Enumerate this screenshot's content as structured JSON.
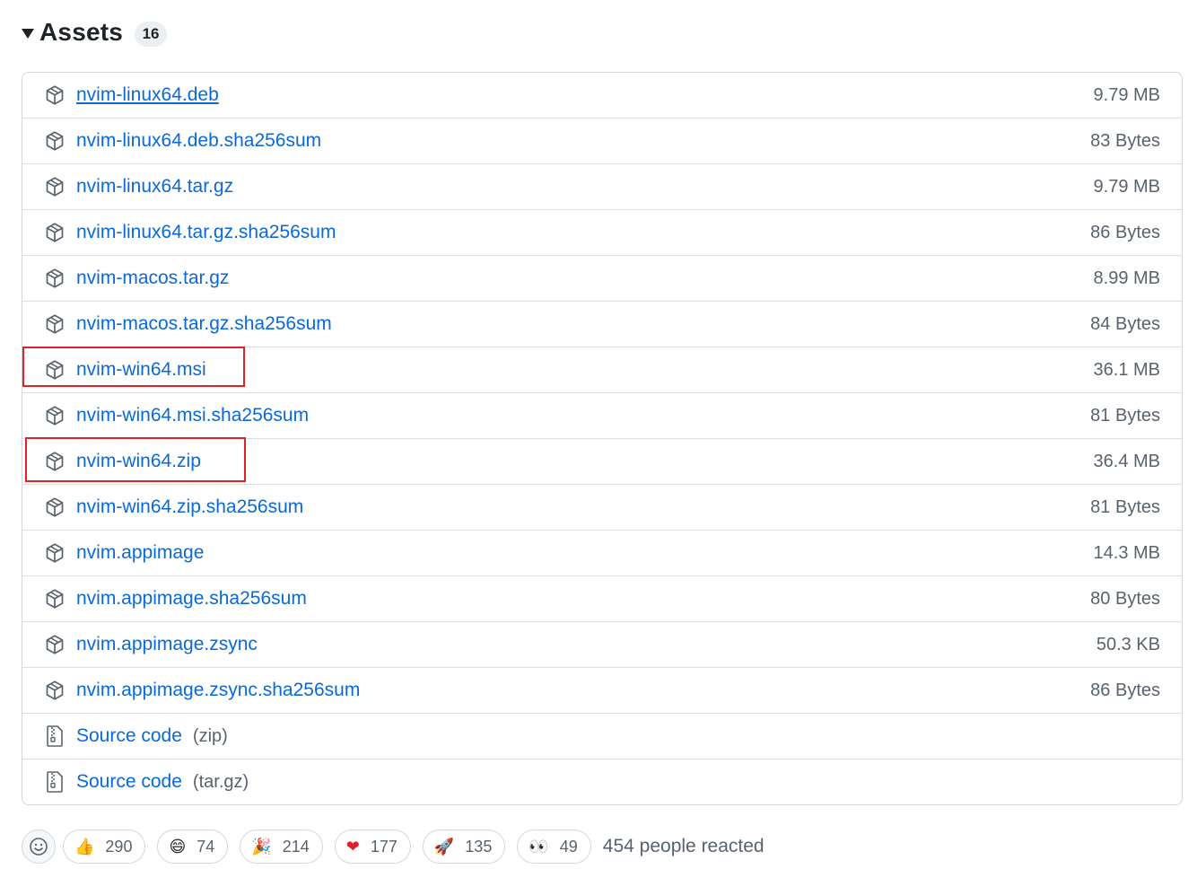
{
  "assets": {
    "title": "Assets",
    "count": "16",
    "files": [
      {
        "name": "nvim-linux64.deb",
        "size": "9.79 MB"
      },
      {
        "name": "nvim-linux64.deb.sha256sum",
        "size": "83 Bytes"
      },
      {
        "name": "nvim-linux64.tar.gz",
        "size": "9.79 MB"
      },
      {
        "name": "nvim-linux64.tar.gz.sha256sum",
        "size": "86 Bytes"
      },
      {
        "name": "nvim-macos.tar.gz",
        "size": "8.99 MB"
      },
      {
        "name": "nvim-macos.tar.gz.sha256sum",
        "size": "84 Bytes"
      },
      {
        "name": "nvim-win64.msi",
        "size": "36.1 MB"
      },
      {
        "name": "nvim-win64.msi.sha256sum",
        "size": "81 Bytes"
      },
      {
        "name": "nvim-win64.zip",
        "size": "36.4 MB"
      },
      {
        "name": "nvim-win64.zip.sha256sum",
        "size": "81 Bytes"
      },
      {
        "name": "nvim.appimage",
        "size": "14.3 MB"
      },
      {
        "name": "nvim.appimage.sha256sum",
        "size": "80 Bytes"
      },
      {
        "name": "nvim.appimage.zsync",
        "size": "50.3 KB"
      },
      {
        "name": "nvim.appimage.zsync.sha256sum",
        "size": "86 Bytes"
      }
    ],
    "source": [
      {
        "label": "Source code",
        "suffix": "(zip)"
      },
      {
        "label": "Source code",
        "suffix": "(tar.gz)"
      }
    ]
  },
  "reactions": {
    "items": [
      {
        "icon": "thumbs-up",
        "emoji": "👍",
        "count": "290"
      },
      {
        "icon": "laugh",
        "emoji": "😄",
        "count": "74"
      },
      {
        "icon": "hooray",
        "emoji": "🎉",
        "count": "214"
      },
      {
        "icon": "heart",
        "emoji": "❤",
        "count": "177"
      },
      {
        "icon": "rocket",
        "emoji": "🚀",
        "count": "135"
      },
      {
        "icon": "eyes",
        "emoji": "👀",
        "count": "49"
      }
    ],
    "summary": "454 people reacted"
  },
  "colors": {
    "link": "#0969da",
    "highlight": "#e0202a",
    "muted": "#59636e"
  }
}
